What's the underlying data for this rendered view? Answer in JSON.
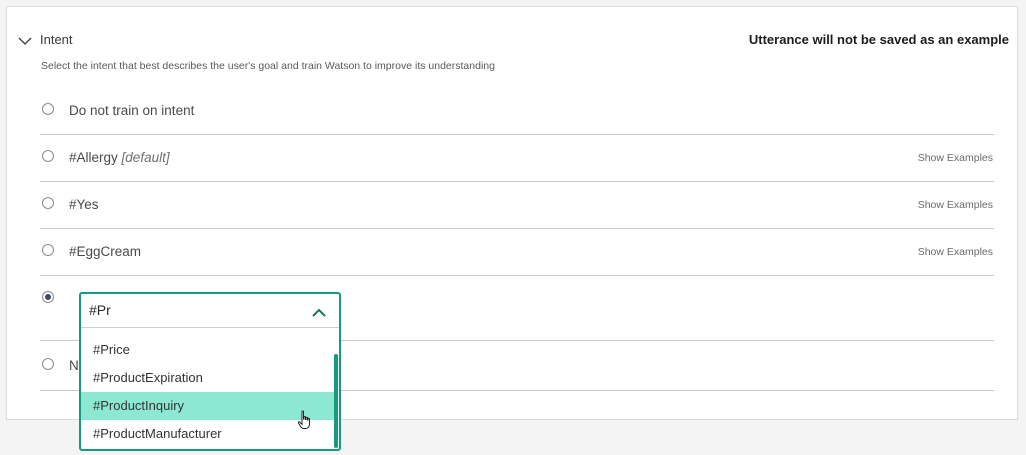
{
  "section": {
    "title": "Intent",
    "note": "Utterance will not be saved as an example",
    "description": "Select the intent that best describes the user's goal and train Watson to improve its understanding"
  },
  "rows": [
    {
      "label": "Do not train on intent",
      "suffix": "",
      "action": ""
    },
    {
      "label": "#Allergy",
      "suffix": "[default]",
      "action": "Show Examples"
    },
    {
      "label": "#Yes",
      "suffix": "",
      "action": "Show Examples"
    },
    {
      "label": "#EggCream",
      "suffix": "",
      "action": "Show Examples"
    }
  ],
  "partial_row_label": "N",
  "combo": {
    "value": "#Pr",
    "options": [
      "#Price",
      "#ProductExpiration",
      "#ProductInquiry",
      "#ProductManufacturer"
    ],
    "highlighted": "#ProductInquiry"
  },
  "colors": {
    "accent": "#139c7f",
    "highlight": "#8ce8d3"
  },
  "icons": {
    "header": "chevron-down-icon",
    "combo": "chevron-up-icon",
    "pointer": "hand-pointer-icon"
  }
}
